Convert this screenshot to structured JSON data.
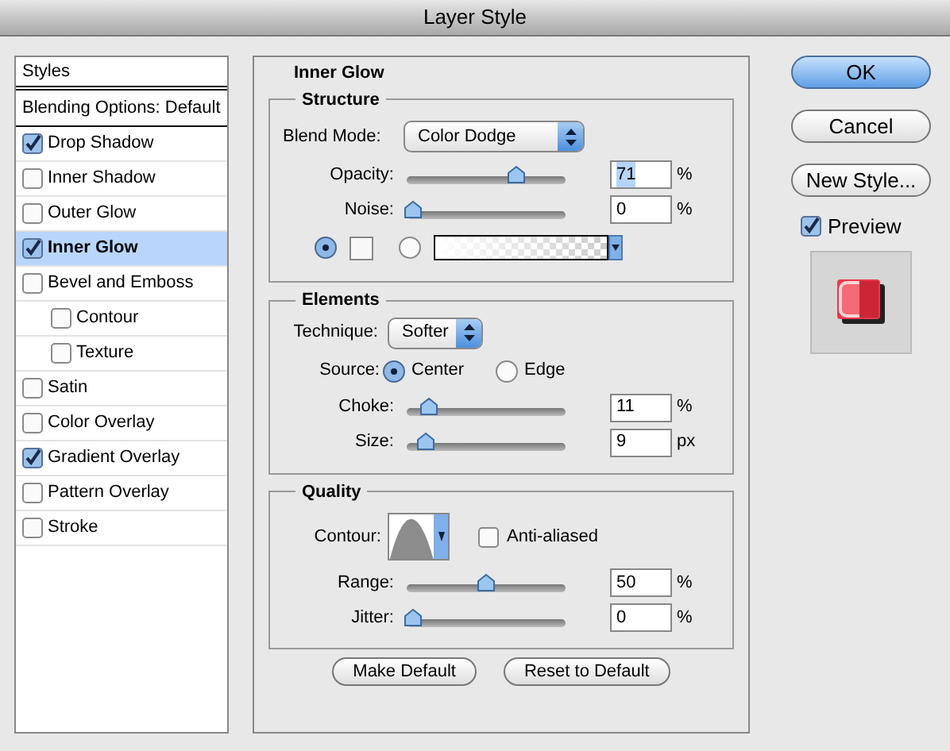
{
  "window": {
    "title": "Layer Style"
  },
  "styles_list": {
    "header": "Styles",
    "blending": "Blending Options: Default",
    "items": [
      {
        "label": "Drop Shadow",
        "checked": true,
        "selected": false
      },
      {
        "label": "Inner Shadow",
        "checked": false,
        "selected": false
      },
      {
        "label": "Outer Glow",
        "checked": false,
        "selected": false
      },
      {
        "label": "Inner Glow",
        "checked": true,
        "selected": true
      },
      {
        "label": "Bevel and Emboss",
        "checked": false,
        "selected": false,
        "children": [
          {
            "label": "Contour",
            "checked": false,
            "selected": false
          },
          {
            "label": "Texture",
            "checked": false,
            "selected": false
          }
        ]
      },
      {
        "label": "Satin",
        "checked": false,
        "selected": false
      },
      {
        "label": "Color Overlay",
        "checked": false,
        "selected": false
      },
      {
        "label": "Gradient Overlay",
        "checked": true,
        "selected": false
      },
      {
        "label": "Pattern Overlay",
        "checked": false,
        "selected": false
      },
      {
        "label": "Stroke",
        "checked": false,
        "selected": false
      }
    ]
  },
  "panel": {
    "title": "Inner Glow",
    "structure": {
      "title": "Structure",
      "blend_mode": {
        "label": "Blend Mode:",
        "value": "Color Dodge"
      },
      "sliders": [
        {
          "label": "Opacity:",
          "level": 0.71,
          "value": "71",
          "unit": "%",
          "highlighted": true
        },
        {
          "label": "Noise:",
          "level": 0,
          "value": "0",
          "unit": "%",
          "highlighted": false
        }
      ],
      "fill": [
        {
          "kind": "color",
          "selected": true
        },
        {
          "kind": "gradient",
          "selected": false
        }
      ]
    },
    "elements": {
      "title": "Elements",
      "technique": {
        "label": "Technique:",
        "value": "Softer"
      },
      "source": {
        "label": "Source:",
        "options": [
          {
            "label": "Center",
            "selected": true
          },
          {
            "label": "Edge",
            "selected": false
          }
        ]
      },
      "sliders": [
        {
          "label": "Choke:",
          "level": 0.11,
          "value": "11",
          "unit": "%",
          "highlighted": false
        },
        {
          "label": "Size:",
          "level": 0.09,
          "value": "9",
          "unit": "px",
          "highlighted": false
        }
      ]
    },
    "quality": {
      "title": "Quality",
      "contour_label": "Contour:",
      "anti_aliased": {
        "label": "Anti-aliased",
        "checked": false
      },
      "sliders": [
        {
          "label": "Range:",
          "level": 0.5,
          "value": "50",
          "unit": "%",
          "highlighted": false
        },
        {
          "label": "Jitter:",
          "level": 0,
          "value": "0",
          "unit": "%",
          "highlighted": false
        }
      ]
    },
    "buttons": [
      "Make Default",
      "Reset to Default"
    ]
  },
  "actions": [
    {
      "label": "OK",
      "default": true
    },
    {
      "label": "Cancel",
      "default": false
    },
    {
      "label": "New Style...",
      "default": false
    }
  ],
  "preview": {
    "label": "Preview",
    "checked": true
  }
}
